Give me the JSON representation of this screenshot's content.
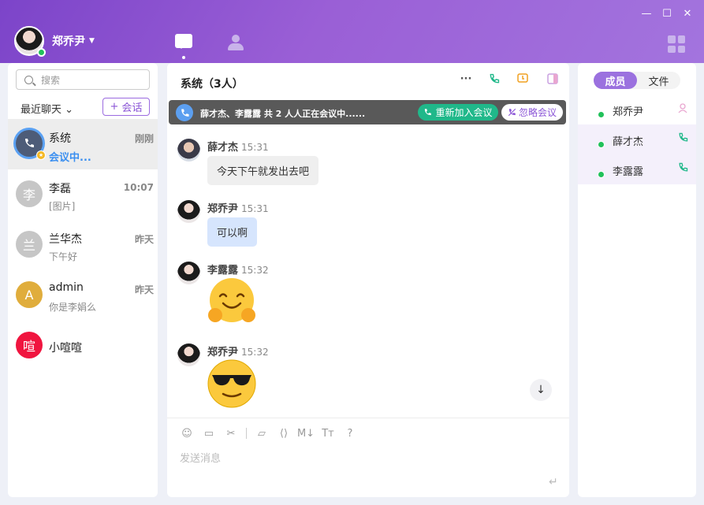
{
  "window": {
    "minimize": "—",
    "maximize": "☐",
    "close": "✕"
  },
  "user": {
    "name": "郑乔尹",
    "caret": "▼"
  },
  "sidebar": {
    "search_placeholder": "搜索",
    "recent_label": "最近聊天 ⌄",
    "new_chat_plus": "+",
    "new_chat_label": "会话",
    "conversations": [
      {
        "avatar_text": "",
        "name": "系统",
        "preview": "会议中...",
        "time": "刚刚"
      },
      {
        "avatar_text": "李",
        "name": "李磊",
        "preview": "[图片]",
        "time": "10:07"
      },
      {
        "avatar_text": "兰",
        "name": "兰华杰",
        "preview": "下午好",
        "time": "昨天"
      },
      {
        "avatar_text": "A",
        "name": "admin",
        "preview": "你是李娟么",
        "time": "昨天"
      },
      {
        "avatar_text": "喧",
        "name": "小喧喧",
        "preview": "",
        "time": ""
      }
    ]
  },
  "chat": {
    "title": "系统（3人）",
    "toolbar": {
      "more": "···"
    },
    "banner": {
      "text": "薛才杰、李露露 共 2 人人正在会议中......",
      "rejoin_label": "重新加入会议",
      "ignore_label": "忽略会议"
    },
    "messages": [
      {
        "name": "薛才杰",
        "time": "15:31",
        "text": "今天下午就发出去吧",
        "style": "grey"
      },
      {
        "name": "郑乔尹",
        "time": "15:31",
        "text": "可以啊",
        "style": "blue"
      },
      {
        "name": "李露露",
        "time": "15:32",
        "emoji": "hugging-face"
      },
      {
        "name": "郑乔尹",
        "time": "15:32",
        "emoji": "sunglasses-face"
      }
    ],
    "input_placeholder": "发送消息",
    "tools": [
      "☺",
      "▭",
      "✂",
      "▱",
      "⟨⟩",
      "M↓",
      "Tт",
      "?"
    ],
    "send_icon": "↵",
    "scroll_down": "↓"
  },
  "members": {
    "tabs": [
      "成员",
      "文件"
    ],
    "list": [
      {
        "name": "郑乔尹"
      },
      {
        "name": "薛才杰"
      },
      {
        "name": "李露露"
      }
    ]
  },
  "colors": {
    "accent": "#9b71df",
    "online": "#21c15a",
    "meeting_green": "#20b88a",
    "link_blue": "#3b8ff0"
  }
}
